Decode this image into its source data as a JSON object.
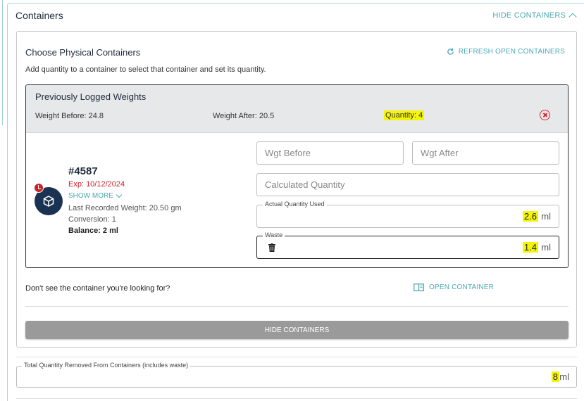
{
  "header": {
    "title": "Containers",
    "hide_link": "HIDE CONTAINERS"
  },
  "card": {
    "title": "Choose Physical Containers",
    "subtitle": "Add quantity to a container to select that container and set its quantity.",
    "refresh_label": "REFRESH OPEN CONTAINERS"
  },
  "logged": {
    "title": "Previously Logged Weights",
    "weight_before": "Weight Before: 24.8",
    "weight_after": "Weight After: 20.5",
    "quantity": "Quantity: 4"
  },
  "item": {
    "number": "#4587",
    "exp": "Exp: 10/12/2024",
    "show_more": "SHOW MORE",
    "last_weight": "Last Recorded Weight: 20.50 gm",
    "conversion": "Conversion: 1",
    "balance": "Balance: 2 ml"
  },
  "fields": {
    "wgt_before_placeholder": "Wgt Before",
    "wgt_after_placeholder": "Wgt After",
    "calc_qty_placeholder": "Calculated Quantity",
    "actual_label": "Actual Quantity Used",
    "actual_value": "2.6",
    "actual_unit": "ml",
    "waste_label": "Waste",
    "waste_value": "1.4",
    "waste_unit": "ml"
  },
  "footer": {
    "dont_see": "Don't see the container you're looking for?",
    "open_container": "OPEN CONTAINER",
    "hide_button": "HIDE CONTAINERS"
  },
  "total": {
    "label": "Total Quantity Removed From Containers (includes waste)",
    "value": "8",
    "unit": "ml"
  },
  "colors": {
    "accent": "#4aa8b1",
    "danger": "#c8232b",
    "navy": "#1b3352",
    "highlight": "#f4f40a"
  }
}
